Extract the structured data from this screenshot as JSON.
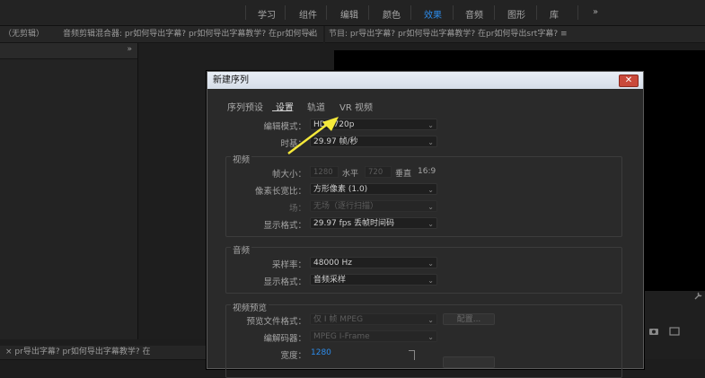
{
  "workspaces": {
    "tabs": [
      "学习",
      "组件",
      "编辑",
      "颜色",
      "效果",
      "音频",
      "图形",
      "库"
    ],
    "active_index": 4,
    "more": "»"
  },
  "left_panel": {
    "tabs_text": "（无剪辑）",
    "header_more": "»"
  },
  "center_panel": {
    "tabs_text": "音频剪辑混合器: pr如何导出字幕? pr如何导出字幕教学? 在pr如何导出"
  },
  "right_panel": {
    "tabs_text": "节目: pr导出字幕? pr如何导出字幕教学? 在pr如何导出srt字幕? ≡",
    "more": "»"
  },
  "bottom_left": {
    "text": "×  pr导出字幕? pr如何导出字幕教学? 在"
  },
  "dialog": {
    "title": "新建序列",
    "close": "✕",
    "tabs": [
      "序列预设",
      "设置",
      "轨道",
      "VR 视频"
    ],
    "active_tab": 1,
    "editing_mode_label": "编辑模式：",
    "editing_mode_value": "HDV 720p",
    "timebase_label": "时基：",
    "timebase_value": "29.97 帧/秒",
    "video": {
      "title": "视频",
      "frame_size_label": "帧大小：",
      "width": "1280",
      "horizontal": "水平",
      "height": "720",
      "vertical": "垂直",
      "aspect": "16:9",
      "pixel_aspect_label": "像素长宽比：",
      "pixel_aspect_value": "方形像素 (1.0)",
      "fields_label": "场：",
      "fields_value": "无场（逐行扫描）",
      "display_format_label": "显示格式：",
      "display_format_value": "29.97 fps 丢帧时间码"
    },
    "audio": {
      "title": "音频",
      "sample_rate_label": "采样率：",
      "sample_rate_value": "48000 Hz",
      "display_format_label": "显示格式：",
      "display_format_value": "音频采样"
    },
    "preview": {
      "title": "视频预览",
      "file_format_label": "预览文件格式：",
      "file_format_value": "仅 I 帧 MPEG",
      "config_button": "配置...",
      "codec_label": "编解码器：",
      "codec_value": "MPEG I-Frame",
      "width_label": "宽度：",
      "width_value": "1280"
    }
  },
  "colors": {
    "accent": "#2d8ceb",
    "arrow": "#f5e93a"
  }
}
